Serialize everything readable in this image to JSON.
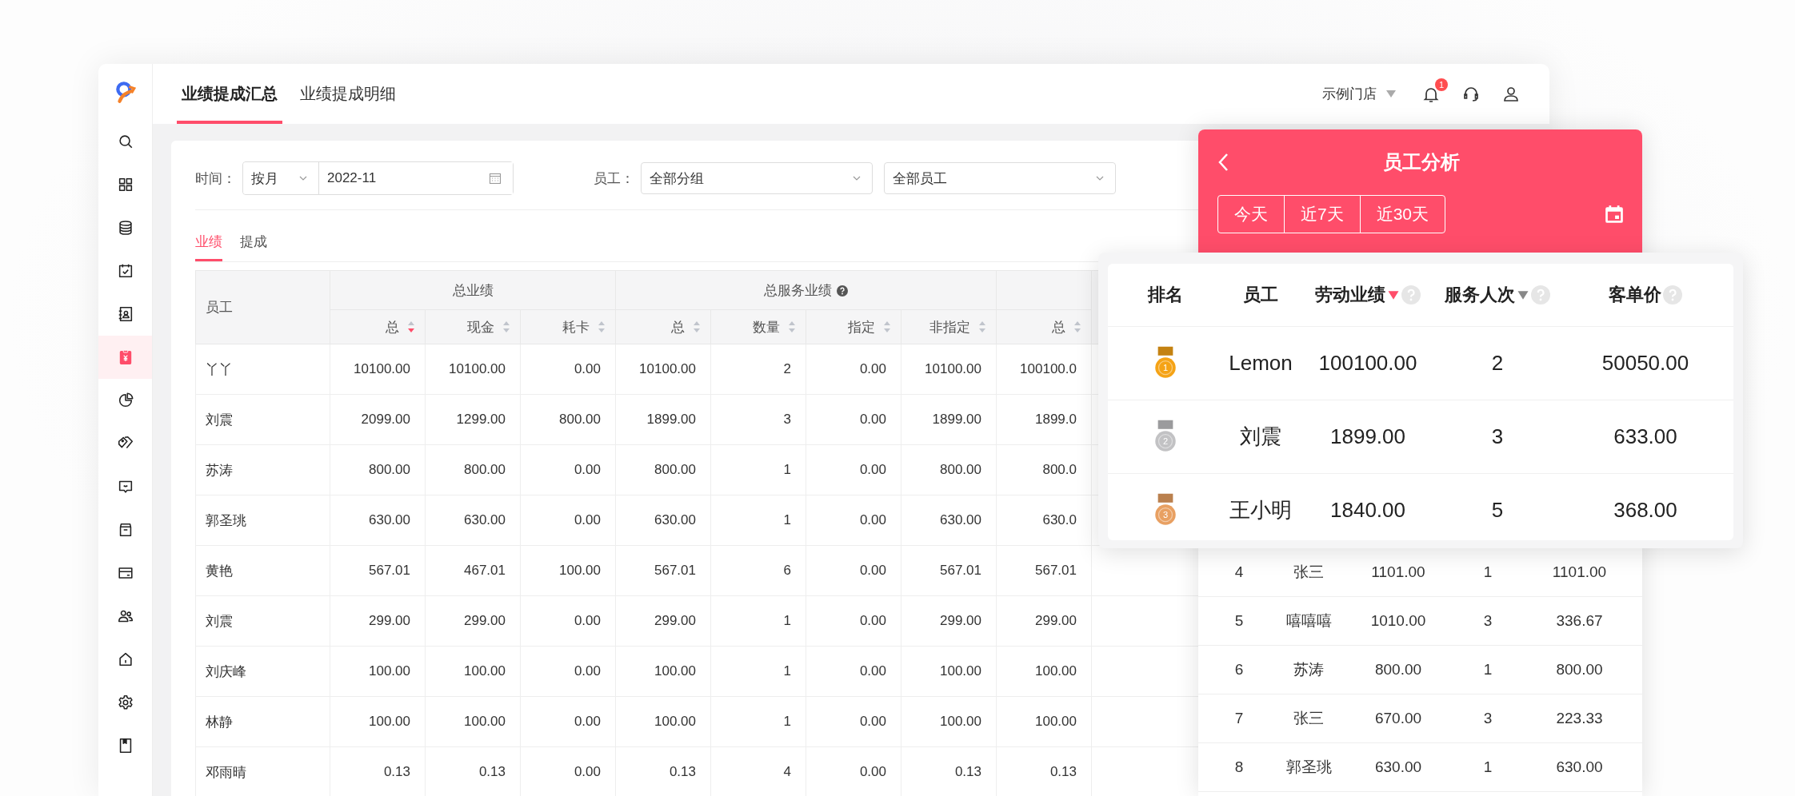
{
  "sidebar": {
    "items": [
      {
        "selected": false
      },
      {
        "selected": false
      },
      {
        "selected": false
      },
      {
        "selected": false
      },
      {
        "selected": false
      },
      {
        "selected": true
      },
      {
        "selected": false
      },
      {
        "selected": false
      },
      {
        "selected": false
      },
      {
        "selected": false
      },
      {
        "selected": false
      },
      {
        "selected": false
      },
      {
        "selected": false
      },
      {
        "selected": false
      },
      {
        "selected": false
      }
    ]
  },
  "header": {
    "tabs": [
      {
        "label": "业绩提成汇总",
        "selected": true
      },
      {
        "label": "业绩提成明细",
        "selected": false
      }
    ],
    "store": "示例门店",
    "notification_badge": "1"
  },
  "filters": {
    "time_label": "时间：",
    "period": "按月",
    "date": "2022-11",
    "employee_label": "员工：",
    "group": "全部分组",
    "employee": "全部员工"
  },
  "subtabs": [
    {
      "label": "业绩",
      "selected": true
    },
    {
      "label": "提成",
      "selected": false
    }
  ],
  "table": {
    "employee_header": "员工",
    "groups": [
      {
        "label": "总业绩",
        "columns": [
          {
            "label": "总",
            "selected": true
          },
          {
            "label": "现金",
            "selected": false
          },
          {
            "label": "耗卡",
            "selected": false
          }
        ]
      },
      {
        "label": "总服务业绩",
        "help": true,
        "columns": [
          {
            "label": "总",
            "selected": false
          },
          {
            "label": "数量",
            "selected": false
          },
          {
            "label": "指定",
            "selected": false
          },
          {
            "label": "非指定",
            "selected": false
          }
        ]
      },
      {
        "columns": [
          {
            "label": "总",
            "selected": false
          }
        ]
      }
    ],
    "rows": [
      {
        "employee": "丫丫",
        "values": [
          "10100.00",
          "10100.00",
          "0.00",
          "10100.00",
          "2",
          "0.00",
          "10100.00",
          "100100.0"
        ]
      },
      {
        "employee": "刘震",
        "values": [
          "2099.00",
          "1299.00",
          "800.00",
          "1899.00",
          "3",
          "0.00",
          "1899.00",
          "1899.0"
        ]
      },
      {
        "employee": "苏涛",
        "values": [
          "800.00",
          "800.00",
          "0.00",
          "800.00",
          "1",
          "0.00",
          "800.00",
          "800.0"
        ]
      },
      {
        "employee": "郭圣珧",
        "values": [
          "630.00",
          "630.00",
          "0.00",
          "630.00",
          "1",
          "0.00",
          "630.00",
          "630.0"
        ]
      },
      {
        "employee": "黄艳",
        "values": [
          "567.01",
          "467.01",
          "100.00",
          "567.01",
          "6",
          "0.00",
          "567.01",
          "567.01"
        ]
      },
      {
        "employee": "刘震",
        "values": [
          "299.00",
          "299.00",
          "0.00",
          "299.00",
          "1",
          "0.00",
          "299.00",
          "299.00"
        ]
      },
      {
        "employee": "刘庆峰",
        "values": [
          "100.00",
          "100.00",
          "0.00",
          "100.00",
          "1",
          "0.00",
          "100.00",
          "100.00"
        ]
      },
      {
        "employee": "林静",
        "values": [
          "100.00",
          "100.00",
          "0.00",
          "100.00",
          "1",
          "0.00",
          "100.00",
          "100.00"
        ]
      },
      {
        "employee": "邓雨晴",
        "values": [
          "0.13",
          "0.13",
          "0.00",
          "0.13",
          "4",
          "0.00",
          "0.13",
          "0.13"
        ]
      }
    ]
  },
  "analysis": {
    "title": "员工分析",
    "ranges": [
      {
        "label": "今天",
        "selected": false
      },
      {
        "label": "近7天",
        "selected": false
      },
      {
        "label": "近30天",
        "selected": false
      }
    ],
    "columns": [
      {
        "label": "排名",
        "kind": "plain"
      },
      {
        "label": "员工",
        "kind": "plain"
      },
      {
        "label": "劳动业绩",
        "kind": "sortable",
        "selected": true
      },
      {
        "label": "服务人次",
        "kind": "sortable",
        "selected": false
      },
      {
        "label": "客单价",
        "kind": "help"
      }
    ],
    "top": [
      {
        "rank": "1",
        "color": "#f5a316",
        "employee": "Lemon",
        "labor": "100100.00",
        "visits": "2",
        "avg": "50050.00"
      },
      {
        "rank": "2",
        "color": "#c2c2c4",
        "employee": "刘震",
        "labor": "1899.00",
        "visits": "3",
        "avg": "633.00"
      },
      {
        "rank": "3",
        "color": "#e8a062",
        "employee": "王小明",
        "labor": "1840.00",
        "visits": "5",
        "avg": "368.00"
      }
    ],
    "rows": [
      {
        "rank": "4",
        "employee": "张三",
        "labor": "1101.00",
        "visits": "1",
        "avg": "1101.00"
      },
      {
        "rank": "5",
        "employee": "嘻嘻嘻",
        "labor": "1010.00",
        "visits": "3",
        "avg": "336.67"
      },
      {
        "rank": "6",
        "employee": "苏涛",
        "labor": "800.00",
        "visits": "1",
        "avg": "800.00"
      },
      {
        "rank": "7",
        "employee": "张三",
        "labor": "670.00",
        "visits": "3",
        "avg": "223.33"
      },
      {
        "rank": "8",
        "employee": "郭圣珧",
        "labor": "630.00",
        "visits": "1",
        "avg": "630.00"
      }
    ]
  }
}
